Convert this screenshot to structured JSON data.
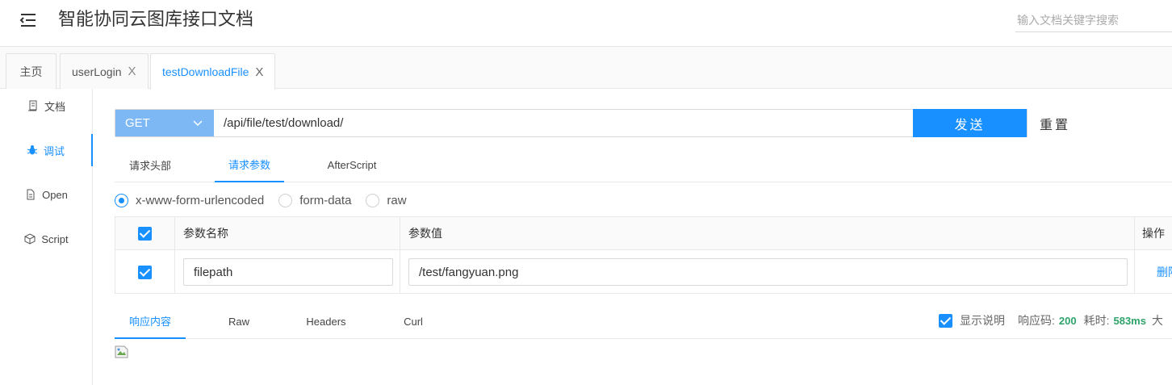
{
  "header": {
    "title": "智能协同云图库接口文档",
    "search_placeholder": "输入文档关键字搜索",
    "menu_icon": "menu-fold-icon"
  },
  "tabs": [
    {
      "label": "主页",
      "closable": false,
      "active": false
    },
    {
      "label": "userLogin",
      "closable": true,
      "active": false
    },
    {
      "label": "testDownloadFile",
      "closable": true,
      "active": true
    }
  ],
  "tab_close_glyph": "X",
  "sidebar": {
    "items": [
      {
        "label": "文档",
        "icon": "document-icon",
        "active": false
      },
      {
        "label": "调试",
        "icon": "bug-icon",
        "active": true
      },
      {
        "label": "Open",
        "icon": "file-icon",
        "active": false
      },
      {
        "label": "Script",
        "icon": "code-sandbox-icon",
        "active": false
      }
    ]
  },
  "request": {
    "method": "GET",
    "url": "/api/file/test/download/",
    "send_label": "发送",
    "reset_label": "重置"
  },
  "request_tabs": [
    {
      "label": "请求头部",
      "active": false
    },
    {
      "label": "请求参数",
      "active": true
    },
    {
      "label": "AfterScript",
      "active": false
    }
  ],
  "content_types": [
    {
      "label": "x-www-form-urlencoded",
      "checked": true
    },
    {
      "label": "form-data",
      "checked": false
    },
    {
      "label": "raw",
      "checked": false
    }
  ],
  "params_table": {
    "columns": {
      "name": "参数名称",
      "value": "参数值",
      "action": "操作"
    },
    "rows": [
      {
        "checked": true,
        "name": "filepath",
        "value": "/test/fangyuan.png",
        "action": "删除"
      }
    ]
  },
  "response_tabs": [
    {
      "label": "响应内容",
      "active": true
    },
    {
      "label": "Raw",
      "active": false
    },
    {
      "label": "Headers",
      "active": false
    },
    {
      "label": "Curl",
      "active": false
    }
  ],
  "response_meta": {
    "show_desc_label": "显示说明",
    "show_desc_checked": true,
    "status_label": "响应码:",
    "status_value": "200",
    "time_label": "耗时:",
    "time_value": "583ms",
    "size_label": "大"
  },
  "colors": {
    "accent": "#1890ff",
    "method_bg": "#7db8f5",
    "success": "#2ea36a"
  }
}
